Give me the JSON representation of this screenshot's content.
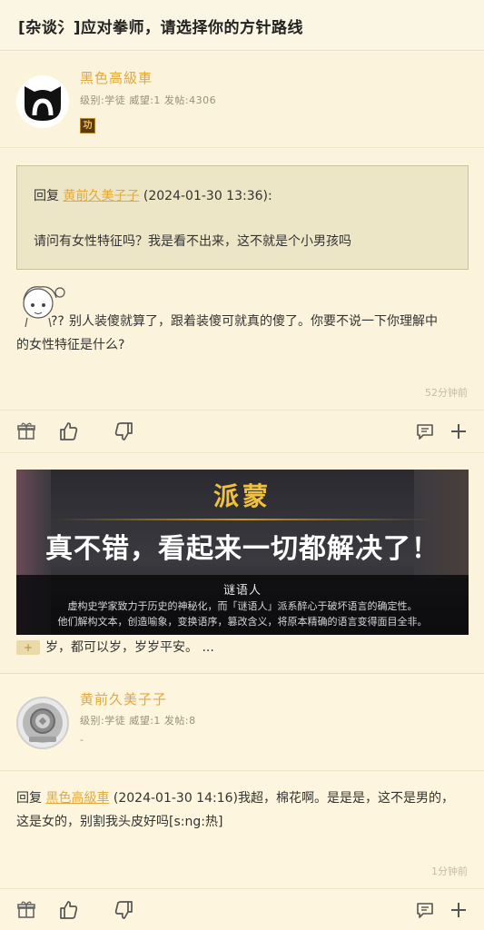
{
  "topbar": {
    "title": "[杂谈氵]应对拳师，请选择你的方针路线"
  },
  "post1": {
    "author": {
      "name": "黑色高級車",
      "meta": "级别:学徒 威望:1 发帖:4306",
      "badge": "功"
    },
    "quote": {
      "reply_prefix": "回复 ",
      "reply_user": "黄前久美子子",
      "reply_time": " (2024-01-30 13:36):",
      "text": "请问有女性特征吗？我是看不出来，这不就是个小男孩吗"
    },
    "body_line1": "别人装傻就算了，跟着装傻可就真的傻了。你要不说一下你理解中",
    "body_line2": "的女性特征是什么?",
    "sticker_marks": "??",
    "time": "52分钟前",
    "image": {
      "name": "派蒙",
      "main": "真不错，看起来一切都解决了！",
      "subtitle": "谜语人",
      "desc_line1": "虚构史学家致力于历史的神秘化，而「谜语人」派系醉心于破坏语言的确定性。",
      "desc_line2": "他们解构文本，创造喻象，变换语序，篡改含义，将原本精确的语言变得面目全非。"
    },
    "trailing_text": "岁，都可以岁，岁岁平安。 ..."
  },
  "post2": {
    "author": {
      "name": "黄前久美子子",
      "meta": "级别:学徒 威望:1 发帖:8",
      "extra": "-"
    },
    "reply_prefix": "回复 ",
    "reply_user": "黑色高級車",
    "reply_rest_line1": " (2024-01-30 14:16)我超，棉花啊。是是是，这不是男的，",
    "body_line2": "这是女的，别割我头皮好吗[s:ng:热]",
    "time": "1分钟前"
  },
  "colors": {
    "accent": "#e2a93d",
    "background": "#fdf7e0",
    "quote_bg": "#ece5c6"
  }
}
